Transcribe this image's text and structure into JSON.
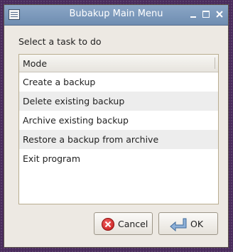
{
  "window": {
    "title": "Bubakup Main Menu"
  },
  "prompt": "Select a task to do",
  "list": {
    "column_header": "Mode",
    "items": [
      "Create a backup",
      "Delete existing backup",
      "Archive existing backup",
      "Restore a backup from archive",
      "Exit program"
    ]
  },
  "buttons": {
    "cancel": {
      "label": "Cancel",
      "icon": "cancel-icon"
    },
    "ok": {
      "label": "OK",
      "icon": "return-arrow-icon"
    }
  },
  "colors": {
    "titlebar": "#7b97bb",
    "window_bg": "#ede9e3",
    "desktop": "#4a2b5c"
  }
}
